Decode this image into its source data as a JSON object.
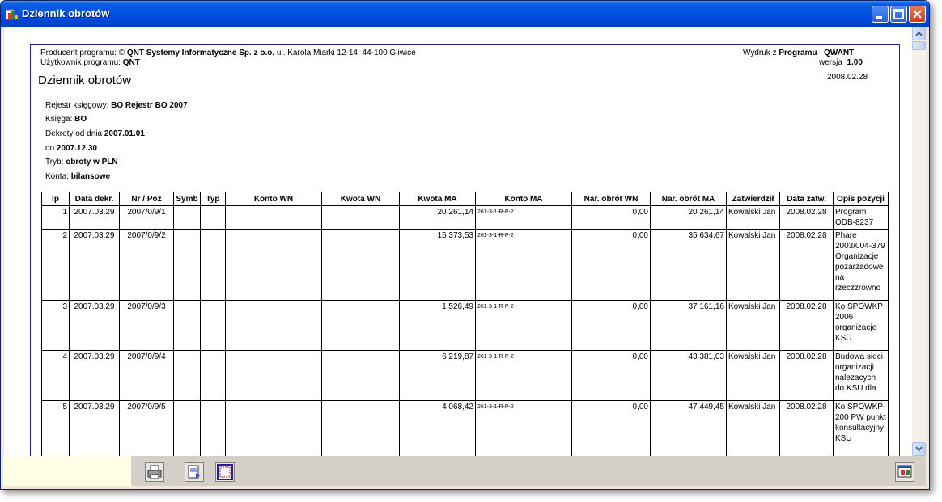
{
  "window": {
    "title": "Dziennik obrotów"
  },
  "header": {
    "producer_prefix": "Producent programu: © ",
    "producer_name": "QNT Systemy Informatyczne Sp. z o.o.",
    "producer_address": " ul. Karola Miarki 12-14, 44-100 Gliwice",
    "user_prefix": "Użytkownik programu: ",
    "user_name": "QNT",
    "printout_prefix": "Wydruk z ",
    "printout_program_label": "Programu",
    "printout_program_name": "QWANT",
    "version_label": "wersja",
    "version_value": "1.00",
    "report_title": "Dziennik obrotów",
    "report_date": "2008.02.28"
  },
  "filters": [
    {
      "label": "Rejestr księgowy:",
      "value": "BO Rejestr BO 2007"
    },
    {
      "label": "Księga:",
      "value": "BO"
    },
    {
      "label": "Dekrety od dnia",
      "value": "2007.01.01"
    },
    {
      "label": "do",
      "value": "2007.12.30"
    },
    {
      "label": "Tryb:",
      "value": "obroty w PLN"
    },
    {
      "label": "Konta:",
      "value": "bilansowe"
    }
  ],
  "table": {
    "columns": [
      "lp",
      "Data dekr.",
      "Nr / Poz",
      "Symb",
      "Typ",
      "Konto WN",
      "Kwota WN",
      "Kwota MA",
      "Konto MA",
      "Nar. obrót WN",
      "Nar. obrót MA",
      "Zatwierdził",
      "Data zatw.",
      "Opis pozycji"
    ],
    "rows": [
      {
        "lp": "1",
        "data": "2007.03.29",
        "nr": "2007/0/9/1",
        "symb": "",
        "typ": "",
        "konto_wn": "",
        "kwota_wn": "",
        "kwota_ma": "20 261,14",
        "konto_ma": "261-3-1-R-P-2",
        "nar_wn": "0,00",
        "nar_ma": "20 261,14",
        "zatw": "Kowalski Jan",
        "data_zatw": "2008.02.28",
        "opis": "Program ODB-8237"
      },
      {
        "lp": "2",
        "data": "2007.03.29",
        "nr": "2007/0/9/2",
        "symb": "",
        "typ": "",
        "konto_wn": "",
        "kwota_wn": "",
        "kwota_ma": "15 373,53",
        "konto_ma": "261-3-1-R-P-2",
        "nar_wn": "0,00",
        "nar_ma": "35 634,67",
        "zatw": "Kowalski Jan",
        "data_zatw": "2008.02.28",
        "opis": "Phare 2003/004-379 Organizacje pozarzadowe na rzeczzrowno"
      },
      {
        "lp": "3",
        "data": "2007.03.29",
        "nr": "2007/0/9/3",
        "symb": "",
        "typ": "",
        "konto_wn": "",
        "kwota_wn": "",
        "kwota_ma": "1 526,49",
        "konto_ma": "261-3-1-R-P-2",
        "nar_wn": "0,00",
        "nar_ma": "37 161,16",
        "zatw": "Kowalski Jan",
        "data_zatw": "2008.02.28",
        "opis": "Ko SPOWKP 2006 organizacje KSU"
      },
      {
        "lp": "4",
        "data": "2007.03.29",
        "nr": "2007/0/9/4",
        "symb": "",
        "typ": "",
        "konto_wn": "",
        "kwota_wn": "",
        "kwota_ma": "6 219,87",
        "konto_ma": "261-3-1-R-P-2",
        "nar_wn": "0,00",
        "nar_ma": "43 381,03",
        "zatw": "Kowalski Jan",
        "data_zatw": "2008.02.28",
        "opis": "Budowa sieci organizacji nalezacych do KSU dla"
      },
      {
        "lp": "5",
        "data": "2007.03.29",
        "nr": "2007/0/9/5",
        "symb": "",
        "typ": "",
        "konto_wn": "",
        "kwota_wn": "",
        "kwota_ma": "4 068,42",
        "konto_ma": "261-3-1-R-P-2",
        "nar_wn": "0,00",
        "nar_ma": "47 449,45",
        "zatw": "Kowalski Jan",
        "data_zatw": "2008.02.28",
        "opis": "Ko SPOWKP-200 PW punkt konsultacyjny KSU"
      }
    ]
  },
  "toolbar": {
    "print_icon": "printer-icon",
    "export_icon": "export-icon",
    "page_icon": "page-view-icon",
    "settings_icon": "report-settings-icon"
  },
  "colors": {
    "titlebar": "#0055e5",
    "report_border": "#20209a",
    "statusbar": "#d4d0c8",
    "status_cell": "#ffffe6"
  }
}
